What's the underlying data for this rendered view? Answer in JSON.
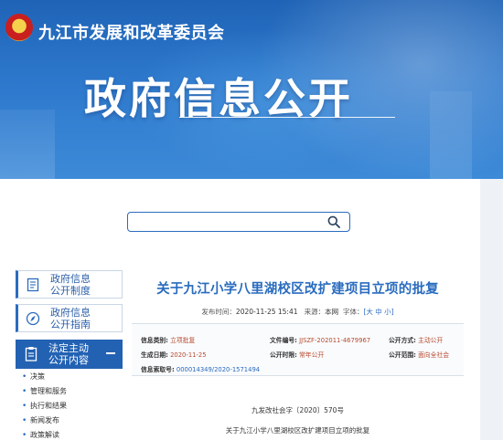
{
  "header": {
    "site_name": "九江市发展和改革委员会",
    "page_heading": "政府信息公开"
  },
  "search": {
    "placeholder": "",
    "icon": "search-icon"
  },
  "sidebar": {
    "items": [
      {
        "label_line1": "政府信息",
        "label_line2": "公开制度",
        "icon": "document-icon",
        "active": false
      },
      {
        "label_line1": "政府信息",
        "label_line2": "公开指南",
        "icon": "compass-icon",
        "active": false
      },
      {
        "label_line1": "法定主动",
        "label_line2": "公开内容",
        "icon": "clipboard-icon",
        "active": true
      }
    ],
    "sub_items": [
      "决策",
      "管理和服务",
      "执行和结果",
      "新闻发布",
      "政策解读"
    ]
  },
  "article": {
    "title": "关于九江小学八里湖校区改扩建项目立项的批复",
    "meta": {
      "publish_label": "发布时间：",
      "publish_value": "2020-11-25 15:41",
      "source_label": "来源：",
      "source_value": "本网",
      "font_label": "字体：",
      "font_sizes": "[大 中 小]"
    },
    "info": {
      "category_label": "信息类别:",
      "category_value": "立项批复",
      "doc_no_label": "文件编号:",
      "doc_no_value": "JJSZF-202011-4679967",
      "method_label": "公开方式:",
      "method_value": "主动公开",
      "date_label": "生成日期:",
      "date_value": "2020-11-25",
      "period_label": "公开时限:",
      "period_value": "常年公开",
      "scope_label": "公开范围:",
      "scope_value": "面向全社会",
      "index_label": "信息索取号:",
      "index_value": "000014349/2020-1571494"
    },
    "doc_number": "九发改社会字〔2020〕570号",
    "doc_title": "关于九江小学八里湖校区改扩建项目立项的批复"
  },
  "colors": {
    "brand_blue": "#2a6cbf",
    "active_blue": "#2362b3",
    "value_red": "#b64a2e"
  }
}
